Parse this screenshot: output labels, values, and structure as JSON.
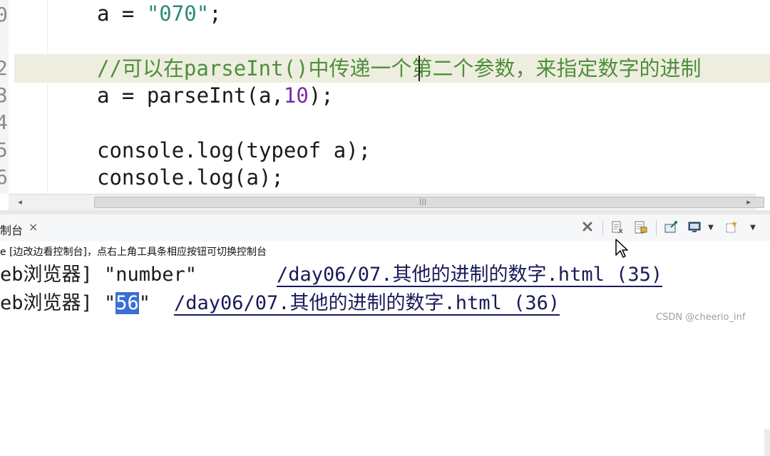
{
  "editor": {
    "gutter_numbers": [
      "0",
      "",
      "2",
      "3",
      "4",
      "5",
      "6"
    ],
    "lines": {
      "l1": {
        "pre": "a = ",
        "str": "\"070\"",
        "post": ";"
      },
      "l3": {
        "comment": "//可以在parseInt()中传递一个第二个参数，来指定数字的进制"
      },
      "l4": {
        "pre": "a = parseInt(a,",
        "num": "10",
        "post": ");"
      },
      "l6": {
        "text": "console.log(typeof a);"
      },
      "l7": {
        "text": "console.log(a);"
      }
    }
  },
  "scrollbar": {
    "grip": "|||",
    "left_arrow": "◂",
    "right_arrow": "▸"
  },
  "console": {
    "tab_label": "制台",
    "tab_close": "⨯",
    "info": "e [边改边看控制台]，点右上角工具条相应按钮可切换控制台",
    "output": [
      {
        "prefix": "eb浏览器] \"number\"",
        "link": "/day06/07.其他的进制的数字.html (35)"
      },
      {
        "prefix_a": "eb浏览器] \"",
        "selected": "56",
        "prefix_b": "\"",
        "link": "/day06/07.其他的进制的数字.html (36)"
      }
    ],
    "toolbar_icons": [
      "clear-icon",
      "page-icon",
      "lock-icon",
      "pin-icon",
      "monitor-icon",
      "new-console-icon"
    ]
  },
  "watermark": "CSDN @cheerio_inf",
  "colors": {
    "string": "#2a8a7a",
    "number": "#7a2aaa",
    "comment": "#4f8f3a",
    "selection": "#3b6fd3",
    "current_line": "#eeeee0"
  }
}
